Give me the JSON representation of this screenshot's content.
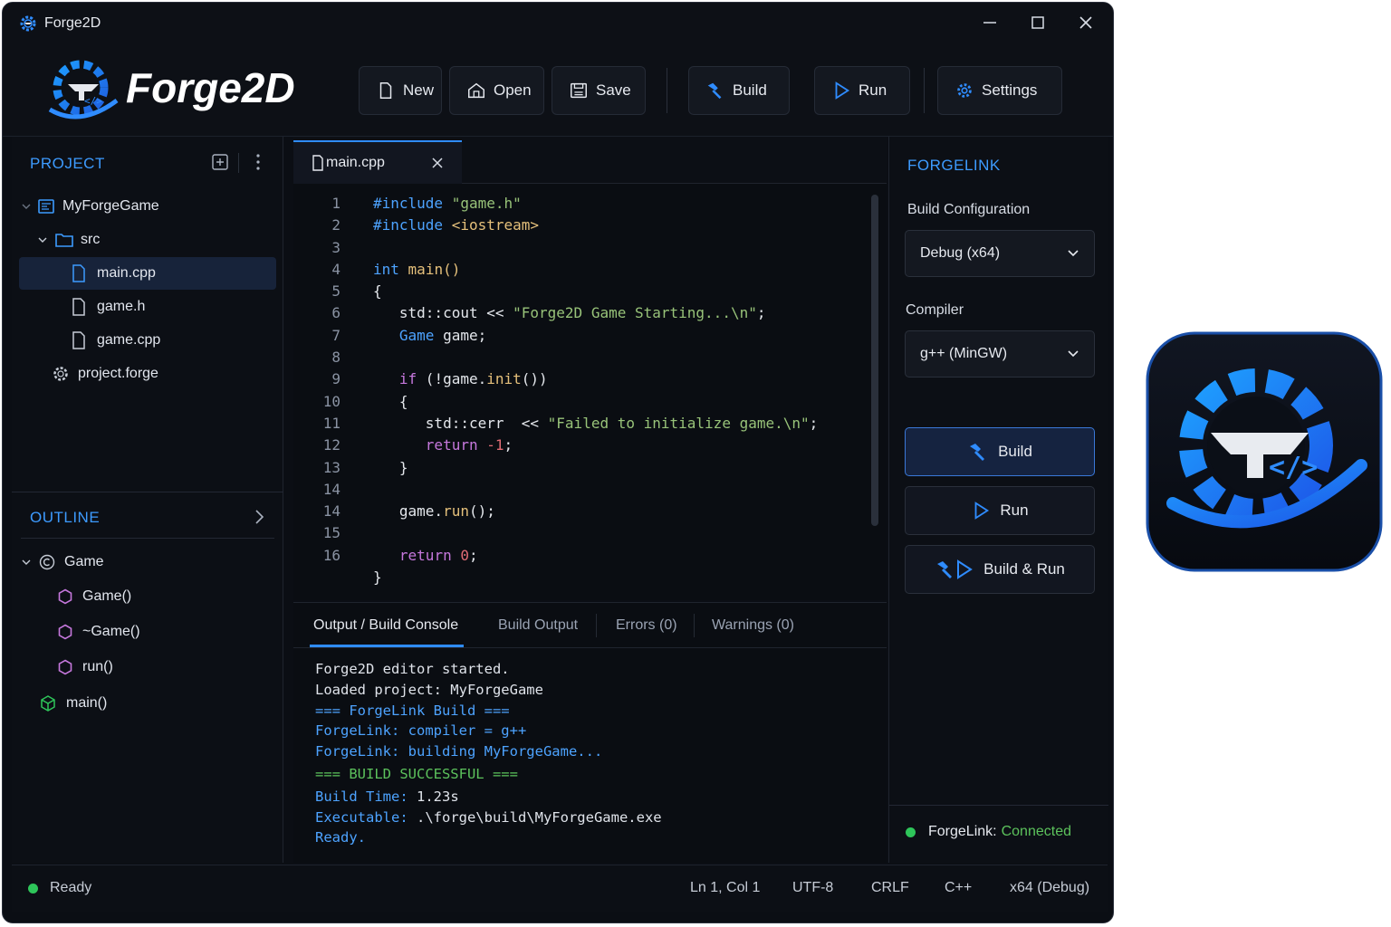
{
  "window": {
    "title": "Forge2D"
  },
  "toolbar": {
    "logo_text": "Forge2D",
    "new_label": "New",
    "open_label": "Open",
    "save_label": "Save",
    "build_label": "Build",
    "run_label": "Run",
    "settings_label": "Settings"
  },
  "project": {
    "title": "PROJECT",
    "tree": {
      "root": "MyForgeGame",
      "folder": "src",
      "file_main": "main.cpp",
      "file_game_h": "game.h",
      "file_game_cpp": "game.cpp",
      "file_project": "project.forge"
    }
  },
  "outline": {
    "title": "OUTLINE",
    "class_name": "Game",
    "members": [
      "Game()",
      "~Game()",
      "run()"
    ],
    "function": "main()"
  },
  "editor": {
    "tab_label": "main.cpp",
    "line_numbers": [
      "1",
      "2",
      "3",
      "4",
      "5",
      "6",
      "7",
      "8",
      "9",
      "10",
      "11",
      "12",
      "13",
      "14",
      "15",
      "16"
    ]
  },
  "output": {
    "tabs": [
      "Output / Build Console",
      "Build Output",
      "Errors (0)",
      "Warnings (0)"
    ],
    "lines": [
      "Forge2D editor started.",
      "Loaded project: MyForgeGame",
      "=== ForgeLink Build ===",
      "ForgeLink: compiler = g++",
      "ForgeLink: building MyForgeGame...",
      "=== BUILD SUCCESSFUL ===",
      "Build Time: 1.23s",
      "Executable: .\\forge\\build\\MyForgeGame.exe",
      "Ready."
    ]
  },
  "forgelink": {
    "title": "FORGELINK",
    "build_config_label": "Build Configuration",
    "build_config_value": "Debug (x64)",
    "compiler_label": "Compiler",
    "compiler_value": "g++ (MinGW)",
    "build_button": "Build",
    "run_button": "Run",
    "build_run_button": "Build & Run",
    "status_label": "ForgeLink:",
    "status_value": "Connected"
  },
  "statusbar": {
    "status": "Ready",
    "cursor": "Ln 1, Col 1",
    "encoding": "UTF-8",
    "line_ending": "CRLF",
    "language": "C++",
    "config": "x64 (Debug)"
  },
  "colors": {
    "accent": "#2f8cff",
    "success": "#2ec55a",
    "background": "#0b0e14"
  }
}
